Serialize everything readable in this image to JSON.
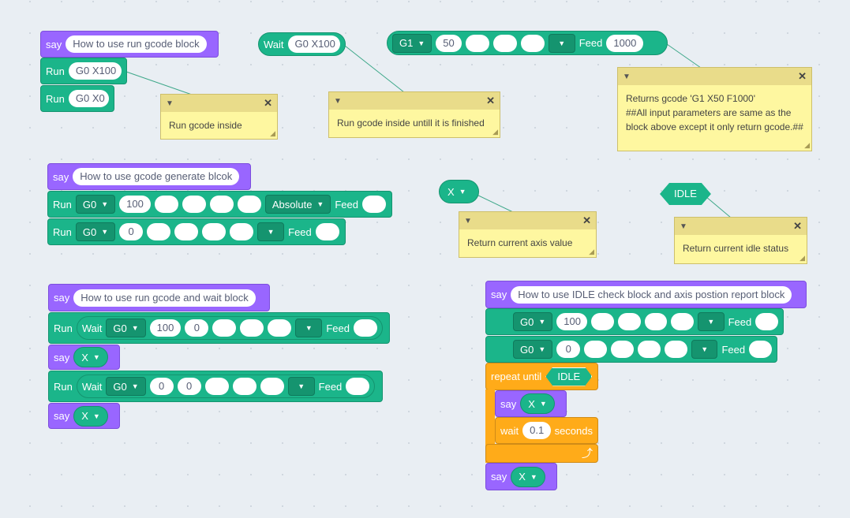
{
  "say_label": "say",
  "run_label": "Run",
  "wait_label": "Wait",
  "feed_label": "Feed",
  "g1_block": {
    "dropdown": "G1",
    "x": "50",
    "feed_value": "1000"
  },
  "wait_block": {
    "text": "G0 X100"
  },
  "group1": {
    "say_text": "How to use run gcode block",
    "run1": "G0 X100",
    "run2": "G0 X0"
  },
  "group2": {
    "say_text": "How to use gcode generate blcok",
    "row1_cmd": "G0",
    "row1_x": "100",
    "row1_mode": "Absolute",
    "row2_cmd": "G0",
    "row2_x": "0"
  },
  "group3": {
    "say_text": "How to use run gcode and wait block",
    "row1_cmd": "G0",
    "row1_x": "100",
    "row1_y": "0",
    "axis1": "X",
    "row2_cmd": "G0",
    "row2_x": "0",
    "row2_y": "0",
    "axis2": "X"
  },
  "axis_reporter": "X",
  "idle_reporter": "IDLE",
  "group4": {
    "say_text": "How to use IDLE check block and axis postion report block",
    "row1_cmd": "G0",
    "row1_x": "100",
    "row2_cmd": "G0",
    "row2_x": "0",
    "repeat_label": "repeat until",
    "idle": "IDLE",
    "inner_axis": "X",
    "wait_word": "wait",
    "wait_value": "0.1",
    "seconds": "seconds",
    "final_axis": "X"
  },
  "notes": {
    "n1": "Run gcode inside",
    "n2": "Run gcode inside untill it is finished",
    "n3": "Returns gcode 'G1 X50 F1000'\n##All input parameters are same as the block above except it only return gcode.##",
    "n4": "Return current axis value",
    "n5": "Return current idle status"
  },
  "colors": {
    "say": "#9966ff",
    "run": "#1bb58a",
    "control": "#ffab19",
    "note": "#fef7a0"
  }
}
